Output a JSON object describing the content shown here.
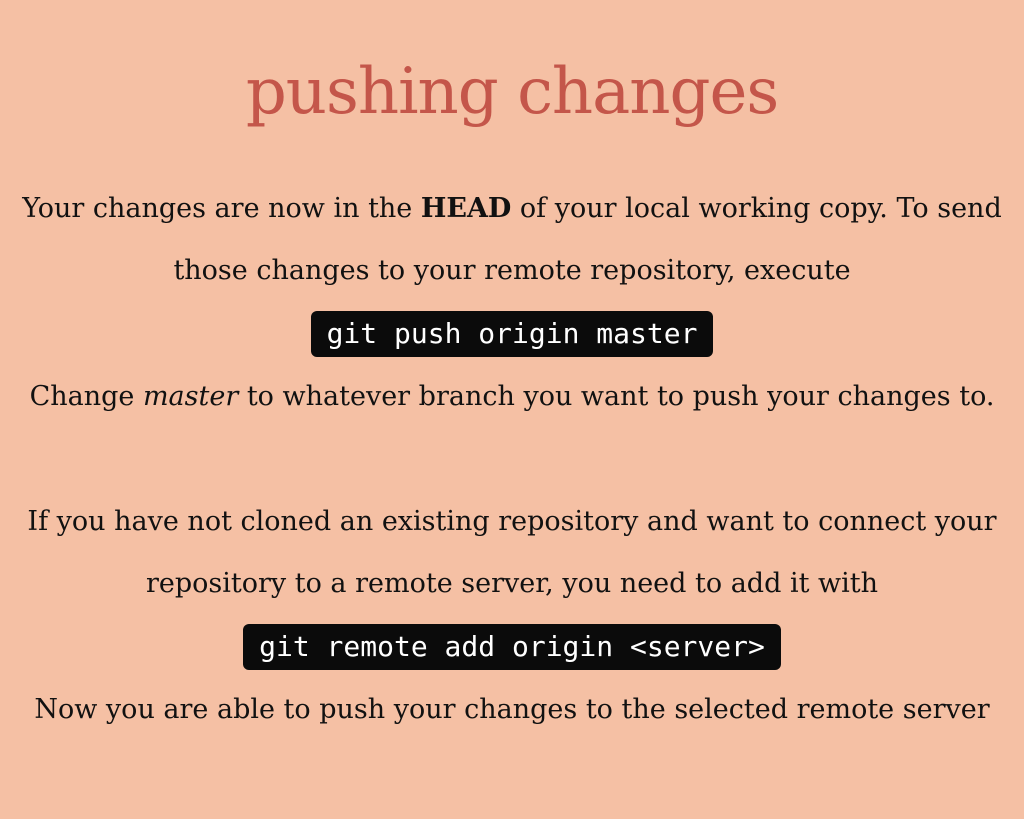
{
  "title": "pushing changes",
  "section1": {
    "line1_before": "Your changes are now in the ",
    "line1_bold": "HEAD",
    "line1_after": " of your local working copy. To send",
    "line2": "those changes to your remote repository, execute",
    "command": "git push origin master",
    "line3_before": "Change ",
    "line3_italic": "master",
    "line3_after": " to whatever branch you want to push your changes to."
  },
  "section2": {
    "line1": "If you have not cloned an existing repository and want to connect your",
    "line2": "repository to a remote server, you need to add it with",
    "command": "git remote add origin <server>",
    "line3": "Now you are able to push your changes to the selected remote server"
  },
  "colors": {
    "background": "#f5c0a4",
    "title": "#c4564a",
    "code_background": "#0b0b0b",
    "code_text": "#ffffff"
  }
}
